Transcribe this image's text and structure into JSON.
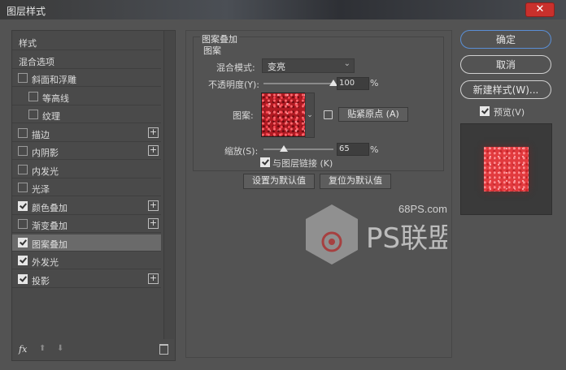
{
  "window": {
    "title": "图层样式",
    "close_symbol": "✕"
  },
  "left_panel": {
    "items": [
      {
        "label": "样式",
        "checkbox": false,
        "checked": false,
        "plus": false,
        "indent": 0
      },
      {
        "label": "混合选项",
        "checkbox": false,
        "checked": false,
        "plus": false,
        "indent": 0
      },
      {
        "label": "斜面和浮雕",
        "checkbox": true,
        "checked": false,
        "plus": false,
        "indent": 0
      },
      {
        "label": "等高线",
        "checkbox": true,
        "checked": false,
        "plus": false,
        "indent": 1
      },
      {
        "label": "纹理",
        "checkbox": true,
        "checked": false,
        "plus": false,
        "indent": 1
      },
      {
        "label": "描边",
        "checkbox": true,
        "checked": false,
        "plus": true,
        "indent": 0
      },
      {
        "label": "内阴影",
        "checkbox": true,
        "checked": false,
        "plus": true,
        "indent": 0
      },
      {
        "label": "内发光",
        "checkbox": true,
        "checked": false,
        "plus": false,
        "indent": 0
      },
      {
        "label": "光泽",
        "checkbox": true,
        "checked": false,
        "plus": false,
        "indent": 0
      },
      {
        "label": "颜色叠加",
        "checkbox": true,
        "checked": true,
        "plus": true,
        "indent": 0
      },
      {
        "label": "渐变叠加",
        "checkbox": true,
        "checked": false,
        "plus": true,
        "indent": 0
      },
      {
        "label": "图案叠加",
        "checkbox": true,
        "checked": true,
        "plus": false,
        "indent": 0,
        "selected": true
      },
      {
        "label": "外发光",
        "checkbox": true,
        "checked": true,
        "plus": false,
        "indent": 0
      },
      {
        "label": "投影",
        "checkbox": true,
        "checked": true,
        "plus": true,
        "indent": 0
      }
    ],
    "footer": {
      "fx": "fx",
      "up": "⬆",
      "down": "⬇"
    }
  },
  "pattern_overlay": {
    "group_title": "图案叠加",
    "sub_title": "图案",
    "blend_mode_label": "混合模式:",
    "blend_mode_value": "变亮",
    "opacity_label": "不透明度(Y):",
    "opacity_value": "100",
    "opacity_fraction": 1.0,
    "pattern_label": "图案:",
    "snap_origin_label": "贴紧原点 (A)",
    "scale_label": "缩放(S):",
    "scale_value": "65",
    "scale_fraction": 0.65,
    "percent_unit": "%",
    "link_layer_label": "与图层链接 (K)",
    "link_layer_checked": true,
    "make_default_label": "设置为默认值",
    "reset_default_label": "复位为默认值"
  },
  "right_panel": {
    "ok_label": "确定",
    "cancel_label": "取消",
    "new_style_label": "新建样式(W)...",
    "preview_label": "预览(V)",
    "preview_checked": true
  },
  "watermark": {
    "site": "68PS.com",
    "brand": "PS联盟"
  },
  "colors": {
    "accent": "#5a8fd6",
    "close": "#c9302c",
    "pattern": "#b01a22"
  }
}
